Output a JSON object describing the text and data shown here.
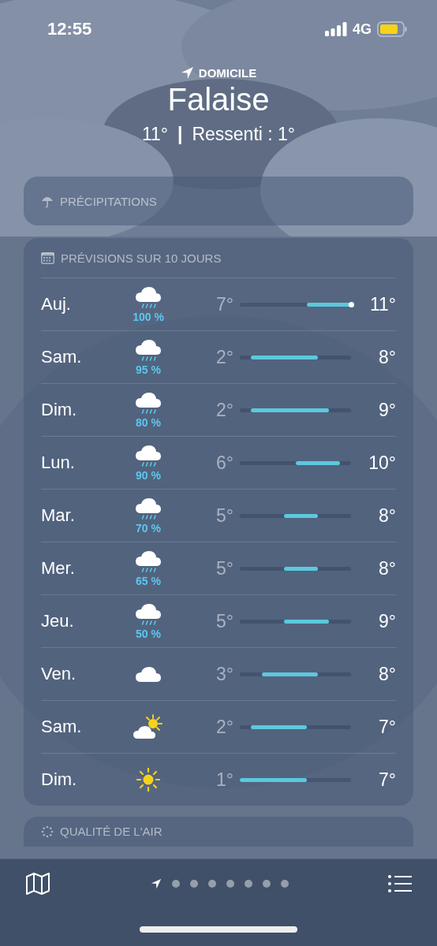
{
  "status_bar": {
    "time": "12:55",
    "network": "4G"
  },
  "location": {
    "label": "DOMICILE",
    "city": "Falaise",
    "temperature": "11°",
    "separator": "|",
    "feels_like": "Ressenti : 1°"
  },
  "precipitation_card": {
    "title": "PRÉCIPITATIONS"
  },
  "forecast": {
    "title": "PRÉVISIONS SUR 10 JOURS",
    "days": [
      {
        "day": "Auj.",
        "kind": "rain",
        "precip": "100 %",
        "low": "7°",
        "high": "11°",
        "now_marker": true
      },
      {
        "day": "Sam.",
        "kind": "rain",
        "precip": "95 %",
        "low": "2°",
        "high": "8°",
        "now_marker": false
      },
      {
        "day": "Dim.",
        "kind": "rain",
        "precip": "80 %",
        "low": "2°",
        "high": "9°",
        "now_marker": false
      },
      {
        "day": "Lun.",
        "kind": "rain",
        "precip": "90 %",
        "low": "6°",
        "high": "10°",
        "now_marker": false
      },
      {
        "day": "Mar.",
        "kind": "rain",
        "precip": "70 %",
        "low": "5°",
        "high": "8°",
        "now_marker": false
      },
      {
        "day": "Mer.",
        "kind": "rain",
        "precip": "65 %",
        "low": "5°",
        "high": "8°",
        "now_marker": false
      },
      {
        "day": "Jeu.",
        "kind": "rain",
        "precip": "50 %",
        "low": "5°",
        "high": "9°",
        "now_marker": false
      },
      {
        "day": "Ven.",
        "kind": "cloud",
        "low": "3°",
        "high": "8°",
        "now_marker": false
      },
      {
        "day": "Sam.",
        "kind": "partly-sunny",
        "low": "2°",
        "high": "7°",
        "now_marker": false
      },
      {
        "day": "Dim.",
        "kind": "sun",
        "low": "1°",
        "high": "7°",
        "now_marker": false
      }
    ]
  },
  "air_quality_card": {
    "title": "QUALITÉ DE L'AIR"
  },
  "tab_bar": {
    "pages": [
      {
        "kind": "location",
        "selected": true
      },
      {
        "kind": "dot",
        "selected": false
      },
      {
        "kind": "dot",
        "selected": false
      },
      {
        "kind": "dot",
        "selected": false
      },
      {
        "kind": "dot",
        "selected": false
      },
      {
        "kind": "dot",
        "selected": false
      },
      {
        "kind": "dot",
        "selected": false
      },
      {
        "kind": "dot",
        "selected": false
      }
    ]
  }
}
